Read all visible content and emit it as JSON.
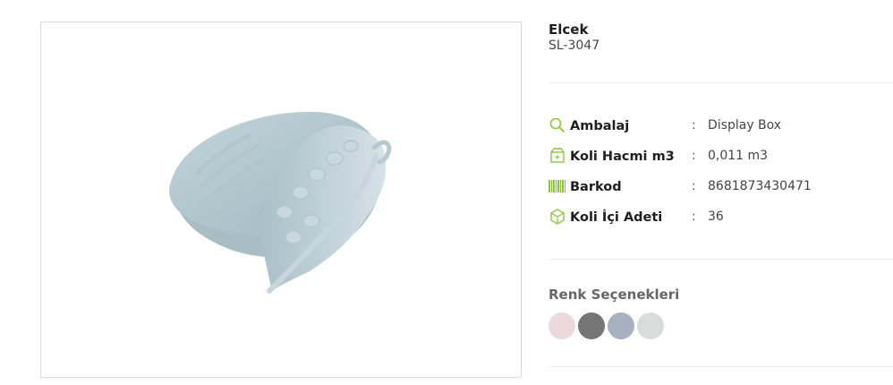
{
  "product": {
    "name": "Elcek",
    "code": "SL-3047"
  },
  "specs": [
    {
      "label": "Ambalaj",
      "value": "Display Box",
      "icon": "search-icon"
    },
    {
      "label": "Koli Hacmi m3",
      "value": "0,011 m3",
      "icon": "box-icon"
    },
    {
      "label": "Barkod",
      "value": "8681873430471",
      "icon": "barcode-icon"
    },
    {
      "label": "Koli İçi Adeti",
      "value": "36",
      "icon": "cube-icon"
    }
  ],
  "separator": ":",
  "colors": {
    "title": "Renk Seçenekleri",
    "swatches": [
      {
        "name": "pink",
        "hex": "#ecd9de"
      },
      {
        "name": "dark-gray",
        "hex": "#757575"
      },
      {
        "name": "blue-gray",
        "hex": "#a7b1c2"
      },
      {
        "name": "light-gray",
        "hex": "#dadcdc"
      }
    ]
  },
  "accent_color": "#8cc63f"
}
